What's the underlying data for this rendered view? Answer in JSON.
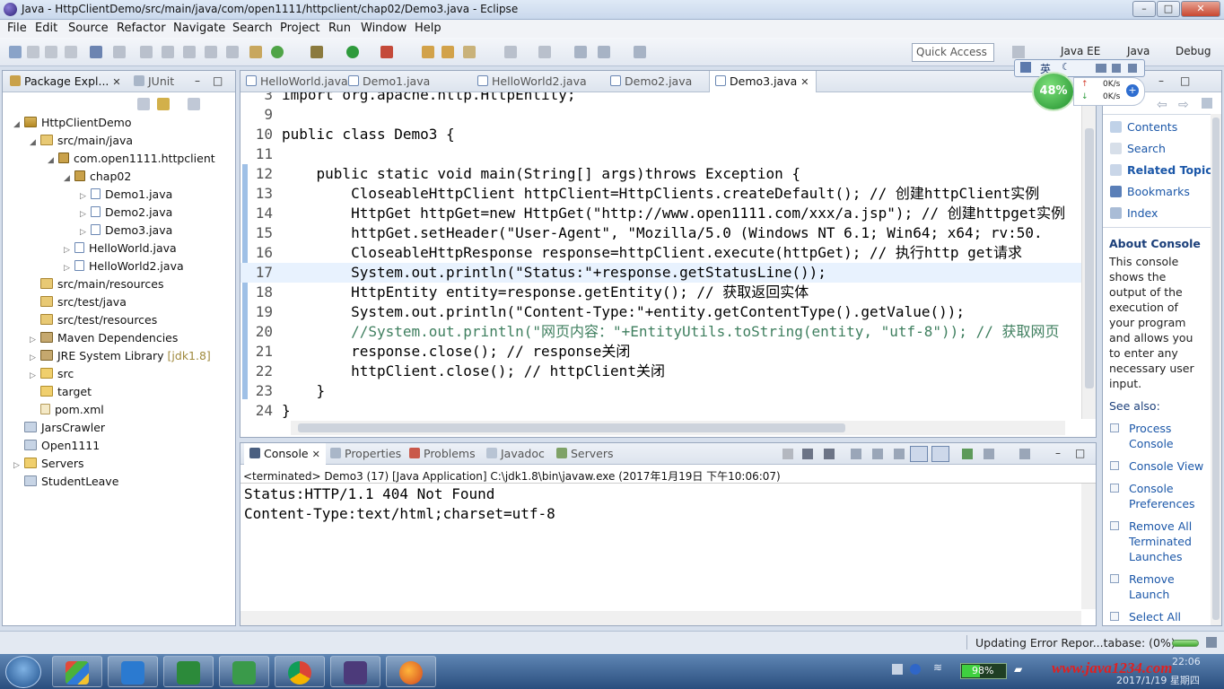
{
  "window": {
    "title": "Java - HttpClientDemo/src/main/java/com/open1111/httpclient/chap02/Demo3.java - Eclipse",
    "buttons": [
      "–",
      "□",
      "✕"
    ]
  },
  "menu": [
    "File",
    "Edit",
    "Source",
    "Refactor",
    "Navigate",
    "Search",
    "Project",
    "Run",
    "Window",
    "Help"
  ],
  "toolbar": {
    "quick_access": "Quick Access",
    "perspectives": [
      "Java EE",
      "Java",
      "Debug"
    ]
  },
  "overlay": {
    "ime_label": "英",
    "cpu_percent": "48%",
    "net_up": "0K/s",
    "net_down": "0K/s"
  },
  "package_explorer": {
    "tabs": [
      "Package Expl...",
      "JUnit"
    ],
    "tree": [
      {
        "label": "HttpClientDemo",
        "icon": "project"
      },
      {
        "label": "src/main/java",
        "icon": "source-folder"
      },
      {
        "label": "com.open1111.httpclient",
        "icon": "package"
      },
      {
        "label": "chap02",
        "icon": "package"
      },
      {
        "label": "Demo1.java",
        "icon": "java-file"
      },
      {
        "label": "Demo2.java",
        "icon": "java-file"
      },
      {
        "label": "Demo3.java",
        "icon": "java-file"
      },
      {
        "label": "HelloWorld.java",
        "icon": "java-file"
      },
      {
        "label": "HelloWorld2.java",
        "icon": "java-file"
      },
      {
        "label": "src/main/resources",
        "icon": "source-folder"
      },
      {
        "label": "src/test/java",
        "icon": "source-folder"
      },
      {
        "label": "src/test/resources",
        "icon": "source-folder"
      },
      {
        "label": "Maven Dependencies",
        "icon": "library"
      },
      {
        "label": "JRE System Library",
        "suffix": "[jdk1.8]",
        "icon": "library"
      },
      {
        "label": "src",
        "icon": "folder"
      },
      {
        "label": "target",
        "icon": "folder"
      },
      {
        "label": "pom.xml",
        "icon": "xml-file"
      },
      {
        "label": "JarsCrawler",
        "icon": "closed-project"
      },
      {
        "label": "Open1111",
        "icon": "closed-project"
      },
      {
        "label": "Servers",
        "icon": "folder"
      },
      {
        "label": "StudentLeave",
        "icon": "closed-project"
      }
    ]
  },
  "editor": {
    "tabs": [
      "HelloWorld.java",
      "Demo1.java",
      "HelloWorld2.java",
      "Demo2.java",
      "Demo3.java"
    ],
    "active_tab": "Demo3.java",
    "lines": [
      {
        "n": "3",
        "code": "import org.apache.http.HttpEntity;"
      },
      {
        "n": "9",
        "code": ""
      },
      {
        "n": "10",
        "code": "public class Demo3 {"
      },
      {
        "n": "11",
        "code": ""
      },
      {
        "n": "12",
        "code": "    public static void main(String[] args)throws Exception {"
      },
      {
        "n": "13",
        "code": "        CloseableHttpClient httpClient=HttpClients.createDefault(); // 创建httpClient实例"
      },
      {
        "n": "14",
        "code": "        HttpGet httpGet=new HttpGet(\"http://www.open1111.com/xxx/a.jsp\"); // 创建httpget实例"
      },
      {
        "n": "15",
        "code": "        httpGet.setHeader(\"User-Agent\", \"Mozilla/5.0 (Windows NT 6.1; Win64; x64; rv:50."
      },
      {
        "n": "16",
        "code": "        CloseableHttpResponse response=httpClient.execute(httpGet); // 执行http get请求"
      },
      {
        "n": "17",
        "code": "        System.out.println(\"Status:\"+response.getStatusLine());"
      },
      {
        "n": "18",
        "code": "        HttpEntity entity=response.getEntity(); // 获取返回实体"
      },
      {
        "n": "19",
        "code": "        System.out.println(\"Content-Type:\"+entity.getContentType().getValue());"
      },
      {
        "n": "20",
        "code": "        //System.out.println(\"网页内容：\"+EntityUtils.toString(entity, \"utf-8\")); // 获取网页"
      },
      {
        "n": "21",
        "code": "        response.close(); // response关闭"
      },
      {
        "n": "22",
        "code": "        httpClient.close(); // httpClient关闭"
      },
      {
        "n": "23",
        "code": "    }"
      },
      {
        "n": "24",
        "code": "}"
      }
    ]
  },
  "console": {
    "tabs": [
      "Console",
      "Properties",
      "Problems",
      "Javadoc",
      "Servers"
    ],
    "header": "<terminated> Demo3 (17) [Java Application] C:\\jdk1.8\\bin\\javaw.exe (2017年1月19日 下午10:06:07)",
    "output": [
      "Status:HTTP/1.1 404 Not Found",
      "Content-Type:text/html;charset=utf-8"
    ]
  },
  "help": {
    "links": [
      "Contents",
      "Search",
      "Related Topics",
      "Bookmarks",
      "Index"
    ],
    "about_title": "About Console",
    "about_lines": [
      "This console",
      "shows the",
      "output of the",
      "execution of",
      "your program",
      "and allows you",
      "to enter any",
      "necessary user",
      "input."
    ],
    "see_also": "See also:",
    "see_links": [
      [
        "Process",
        "Console"
      ],
      [
        "Console View"
      ],
      [
        "Console",
        "Preferences"
      ],
      [
        "Remove All",
        "Terminated",
        "Launches"
      ],
      [
        "Remove",
        "Launch"
      ],
      [
        "Select All"
      ]
    ]
  },
  "status": {
    "job": "Updating Error Repor...tabase: (0%)"
  },
  "taskbar": {
    "battery": "98%",
    "watermark": "www.java1234.com",
    "time": "22:06",
    "date": "2017/1/19 星期四"
  }
}
